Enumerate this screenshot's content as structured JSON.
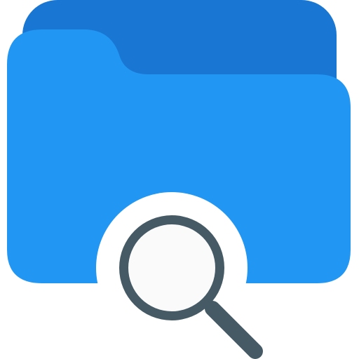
{
  "icon": {
    "name": "folder-search-icon",
    "colors": {
      "folder_back": "#1976D2",
      "folder_front": "#2196F3",
      "cutout": "#FFFFFF",
      "lens_ring": "#455A64",
      "lens_glass": "#FAFAFA",
      "handle": "#455A64"
    }
  }
}
